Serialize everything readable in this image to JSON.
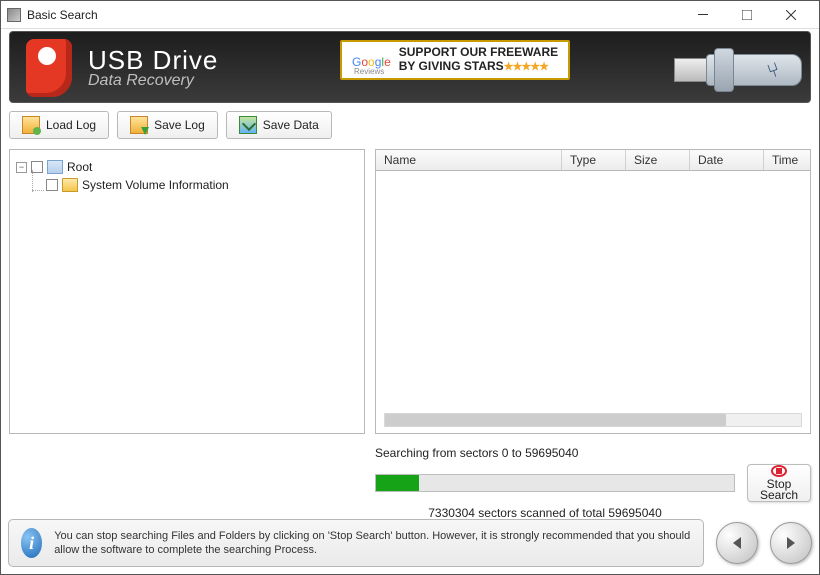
{
  "window": {
    "title": "Basic Search"
  },
  "brand": {
    "line1": "USB Drive",
    "line2": "Data Recovery"
  },
  "ad": {
    "support_l1": "SUPPORT OUR FREEWARE",
    "support_l2": "BY GIVING STARS",
    "reviews": "Reviews"
  },
  "toolbar": {
    "load_log": "Load Log",
    "save_log": "Save Log",
    "save_data": "Save Data"
  },
  "tree": {
    "root": "Root",
    "child1": "System Volume Information"
  },
  "columns": {
    "name": "Name",
    "type": "Type",
    "size": "Size",
    "date": "Date",
    "time": "Time"
  },
  "progress": {
    "label": "Searching from sectors   0 to 59695040",
    "scanned": "7330304",
    "total": "59695040",
    "subtext_mid": "  sectors scanned of total ",
    "stop_l1": "Stop",
    "stop_l2": "Search"
  },
  "info": {
    "text": "You can stop searching Files and Folders by clicking on 'Stop Search' button. However, it is strongly recommended that you should allow the software to complete the searching Process."
  }
}
